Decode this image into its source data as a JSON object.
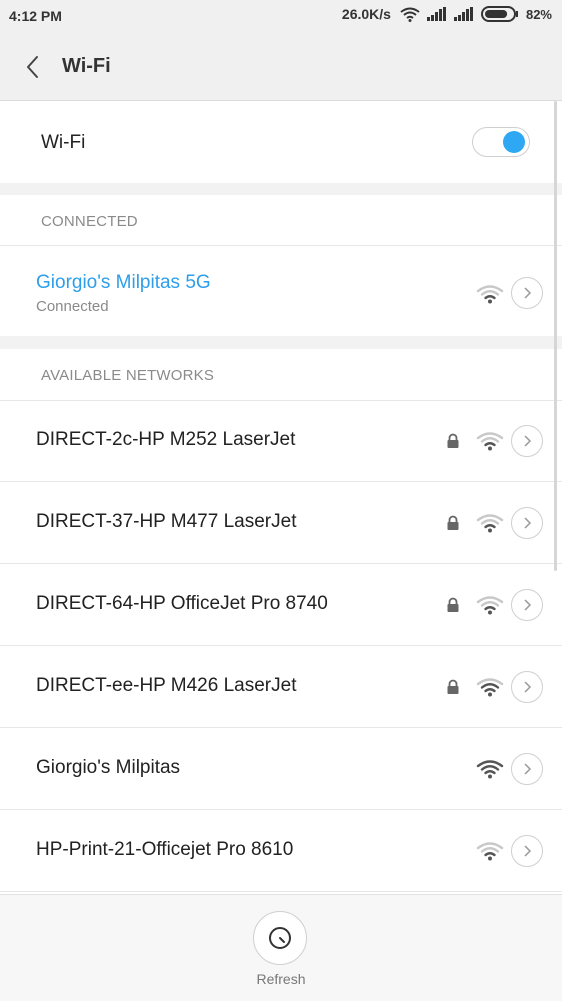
{
  "status_bar": {
    "time": "4:12 PM",
    "speed": "26.0K/s",
    "battery_pct": "82%",
    "battery_level": 0.82
  },
  "header": {
    "title": "Wi-Fi",
    "back_icon": "chevron-left-icon"
  },
  "wifi_toggle": {
    "label": "Wi-Fi",
    "enabled": true,
    "accent": "#2ea8f2"
  },
  "connected": {
    "section_title": "CONNECTED",
    "network": {
      "name": "Giorgio's Milpitas 5G",
      "status": "Connected",
      "secured": false,
      "signal": 2
    }
  },
  "available": {
    "section_title": "AVAILABLE NETWORKS",
    "networks": [
      {
        "name": "DIRECT-2c-HP M252 LaserJet",
        "secured": true,
        "signal": 2
      },
      {
        "name": "DIRECT-37-HP M477 LaserJet",
        "secured": true,
        "signal": 2
      },
      {
        "name": "DIRECT-64-HP OfficeJet Pro 8740",
        "secured": true,
        "signal": 2
      },
      {
        "name": "DIRECT-ee-HP M426 LaserJet",
        "secured": true,
        "signal": 3
      },
      {
        "name": "Giorgio's Milpitas",
        "secured": false,
        "signal": 4
      },
      {
        "name": "HP-Print-21-Officejet Pro 8610",
        "secured": false,
        "signal": 2
      }
    ]
  },
  "bottom": {
    "refresh_label": "Refresh"
  },
  "colors": {
    "accent_blue": "#2e9ee8",
    "text_primary": "#222222",
    "text_secondary": "#8a8a8a"
  }
}
